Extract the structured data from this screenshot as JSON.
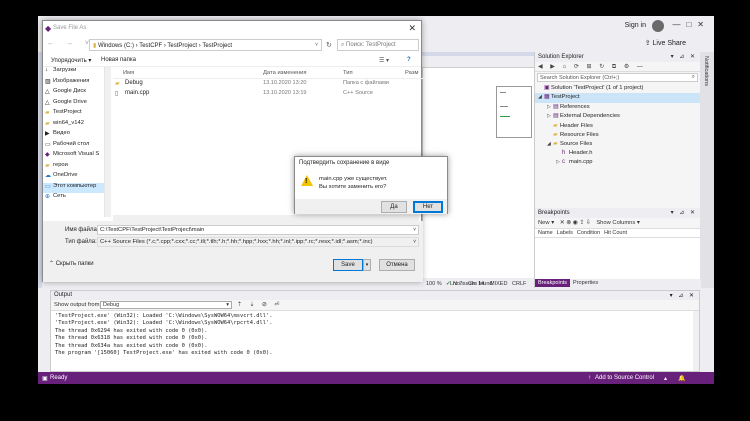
{
  "vs": {
    "sign_in": "Sign in",
    "live_share": "Live Share",
    "status_ready": "Ready",
    "status_source_control": "Add to Source Control",
    "right_strip_label": "Notifications",
    "colors": {
      "accent": "#68217a",
      "selection": "#cce8ff"
    }
  },
  "editor_status": {
    "zoom": "100 %",
    "issues": "No issues found",
    "line": "Ln: 7",
    "col": "Ch: 14",
    "mixed": "MIXED",
    "crlf": "CRLF"
  },
  "solution_explorer": {
    "title": "Solution Explorer",
    "search_placeholder": "Search Solution Explorer (Ctrl+;)",
    "items": [
      {
        "label": "Solution 'TestProject' (1 of 1 project)",
        "depth": 0,
        "arrow": "",
        "icon": "solution-icon"
      },
      {
        "label": "TestProject",
        "depth": 0,
        "arrow": "◢",
        "icon": "project-icon",
        "selected": true
      },
      {
        "label": "References",
        "depth": 1,
        "arrow": "▷",
        "icon": "references-icon"
      },
      {
        "label": "External Dependencies",
        "depth": 1,
        "arrow": "▷",
        "icon": "dependencies-icon"
      },
      {
        "label": "Header Files",
        "depth": 1,
        "arrow": "",
        "icon": "folder-icon"
      },
      {
        "label": "Resource Files",
        "depth": 1,
        "arrow": "",
        "icon": "folder-icon"
      },
      {
        "label": "Source Files",
        "depth": 1,
        "arrow": "◢",
        "icon": "folder-icon"
      },
      {
        "label": "Header.h",
        "depth": 2,
        "arrow": "",
        "icon": "header-file-icon"
      },
      {
        "label": "main.cpp",
        "depth": 2,
        "arrow": "▷",
        "icon": "cpp-file-icon"
      }
    ]
  },
  "breakpoints": {
    "title": "Breakpoints",
    "new_label": "New ▾",
    "show_columns": "Show Columns ▾",
    "columns": [
      "Name",
      "Labels",
      "Condition",
      "Hit Count"
    ],
    "tabs": [
      "Breakpoints",
      "Properties"
    ]
  },
  "output": {
    "title": "Output",
    "show_output_from": "Show output from:",
    "source": "Debug",
    "lines": [
      "'TestProject.exe' (Win32): Loaded 'C:\\Windows\\SysWOW64\\msvcrt.dll'.",
      "'TestProject.exe' (Win32): Loaded 'C:\\Windows\\SysWOW64\\rpcrt4.dll'.",
      "The thread 0x6294 has exited with code 0 (0x0).",
      "The thread 0x6318 has exited with code 0 (0x0).",
      "The thread 0x634a has exited with code 0 (0x0).",
      "The program '[15060] TestProject.exe' has exited with code 0 (0x0)."
    ]
  },
  "save_dialog": {
    "title": "Save File As",
    "path": "Windows (C:)  ›  TestCPF  ›  TestProject  ›  TestProject",
    "search_placeholder": "Поиск: TestProject",
    "organize": "Упорядочить ▾",
    "new_folder": "Новая папка",
    "sidebar": [
      {
        "label": "Загрузки",
        "icon": "downloads-icon"
      },
      {
        "label": "Изображения",
        "icon": "pictures-icon"
      },
      {
        "label": "Google Диск",
        "icon": "google-drive-icon"
      },
      {
        "label": "Google Drive",
        "icon": "google-drive-icon"
      },
      {
        "label": "TestProject",
        "icon": "folder-icon"
      },
      {
        "label": "win64_v142",
        "icon": "folder-icon"
      },
      {
        "label": "Видео",
        "icon": "video-icon"
      },
      {
        "label": "Рабочий стол",
        "icon": "desktop-icon"
      },
      {
        "label": "Microsoft Visual S",
        "icon": "vs-icon"
      },
      {
        "label": "герои",
        "icon": "folder-icon"
      },
      {
        "label": "OneDrive",
        "icon": "onedrive-icon"
      },
      {
        "label": "Этот компьютер",
        "icon": "computer-icon",
        "selected": true
      },
      {
        "label": "Сеть",
        "icon": "network-icon"
      }
    ],
    "columns": {
      "name": "Имя",
      "date": "Дата изменения",
      "type": "Тип",
      "size": "Разм"
    },
    "files": [
      {
        "name": "Debug",
        "date": "13.10.2020 13:20",
        "type": "Папка с файлами",
        "icon": "folder-icon"
      },
      {
        "name": "main.cpp",
        "date": "13.10.2020 13:19",
        "type": "C++ Source",
        "icon": "cpp-file-icon"
      }
    ],
    "filename_label": "Имя файла:",
    "filename_value": "C:\\TestCPF\\TestProject\\TestProject\\main",
    "filetype_label": "Тип файла:",
    "filetype_value": "C++ Source Files (*.c;*.cpp;*.cxx;*.cc;*.tli;*.tlh;*.h;*.hh;*.hpp;*.hxx;*.hh;*.inl;*.ipp;*.rc;*.resx;*.idl;*.asm;*.inc)",
    "hide_folders": "Скрыть папки",
    "save": "Save",
    "cancel": "Отмена"
  },
  "confirm_dialog": {
    "title": "Подтвердить сохранение в виде",
    "message_line1": "main.cpp уже существует.",
    "message_line2": "Вы хотите заменить его?",
    "yes": "Да",
    "no": "Нет"
  }
}
